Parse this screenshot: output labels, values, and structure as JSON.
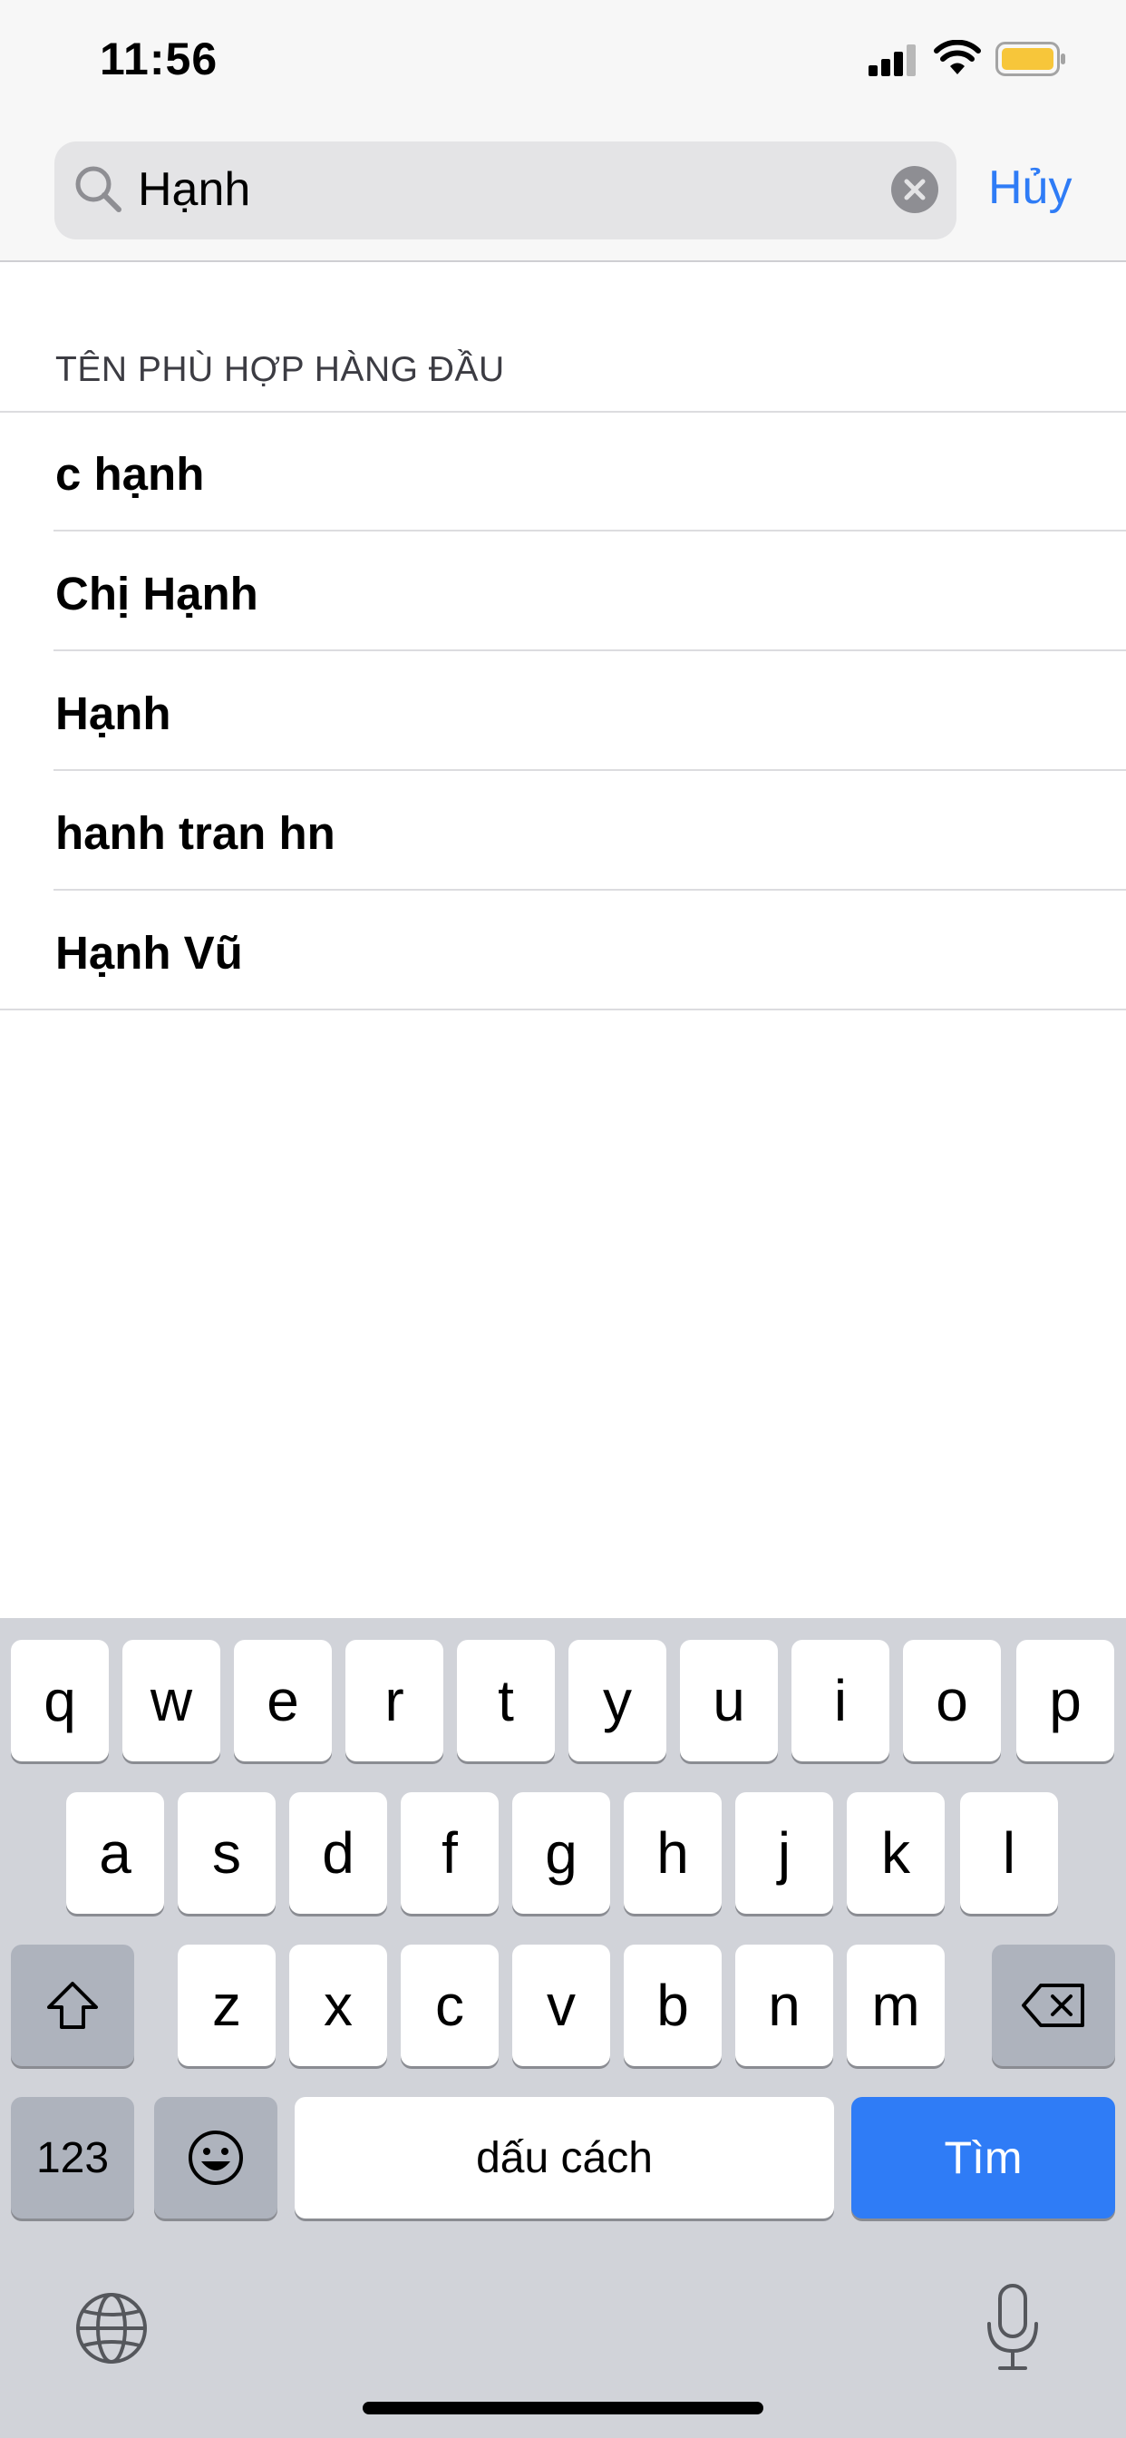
{
  "status_bar": {
    "time": "11:56",
    "battery_color": "#f7c63a",
    "icons": [
      "cellular-signal-icon",
      "wifi-icon",
      "battery-icon"
    ]
  },
  "search": {
    "value": "Hạnh",
    "cancel_label": "Hủy"
  },
  "results": {
    "section_title": "TÊN PHÙ HỢP HÀNG ĐẦU",
    "items": [
      "c hạnh",
      "Chị Hạnh",
      "Hạnh",
      "hanh tran hn",
      "Hạnh Vũ"
    ]
  },
  "keyboard": {
    "row1": [
      "q",
      "w",
      "e",
      "r",
      "t",
      "y",
      "u",
      "i",
      "o",
      "p"
    ],
    "row2": [
      "a",
      "s",
      "d",
      "f",
      "g",
      "h",
      "j",
      "k",
      "l"
    ],
    "row3": [
      "z",
      "x",
      "c",
      "v",
      "b",
      "n",
      "m"
    ],
    "numbers_label": "123",
    "space_label": "dấu cách",
    "search_label": "Tìm",
    "accent_color": "#2f7cf6"
  }
}
